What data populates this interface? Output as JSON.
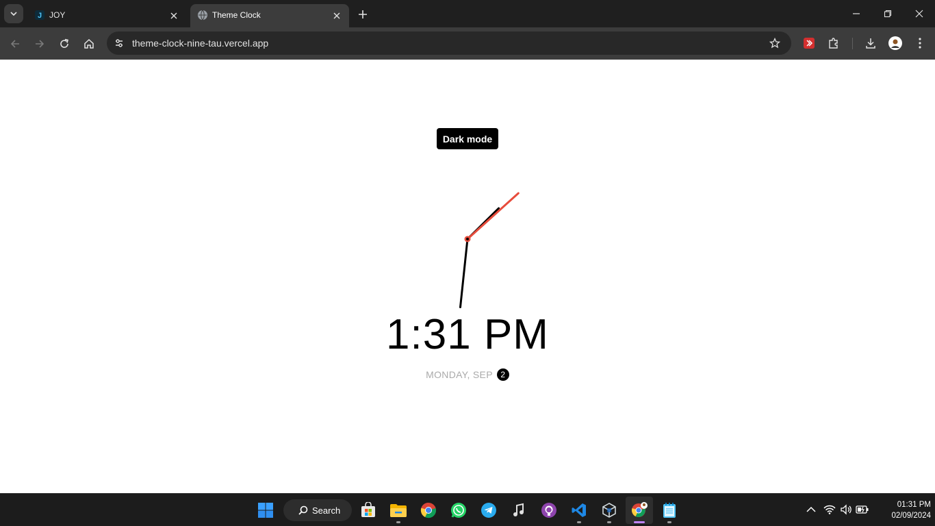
{
  "browser": {
    "tabs": [
      {
        "title": "JOY",
        "active": false
      },
      {
        "title": "Theme Clock",
        "active": true
      }
    ],
    "url": "theme-clock-nine-tau.vercel.app"
  },
  "page": {
    "toggle_label": "Dark mode",
    "time": "1:31 PM",
    "date_text": "MONDAY, SEP",
    "date_day": "2",
    "clock": {
      "hour": 1,
      "minute": 31,
      "second": 8,
      "hand_color": "#000000",
      "second_hand_color": "#e74c3c"
    }
  },
  "taskbar": {
    "search_label": "Search",
    "apps": [
      "windows-start",
      "microsoft-store",
      "file-explorer",
      "chrome",
      "whatsapp",
      "telegram",
      "music-app",
      "github-desktop",
      "vscode",
      "virtualbox",
      "chrome-profile",
      "notepad"
    ],
    "time": "01:31 PM",
    "date": "02/09/2024"
  },
  "colors": {
    "chrome_dark": "#1f1f1f",
    "toolbar": "#3c3c3c",
    "accent_red": "#e74c3c",
    "taskbar": "#1c1c1c"
  }
}
